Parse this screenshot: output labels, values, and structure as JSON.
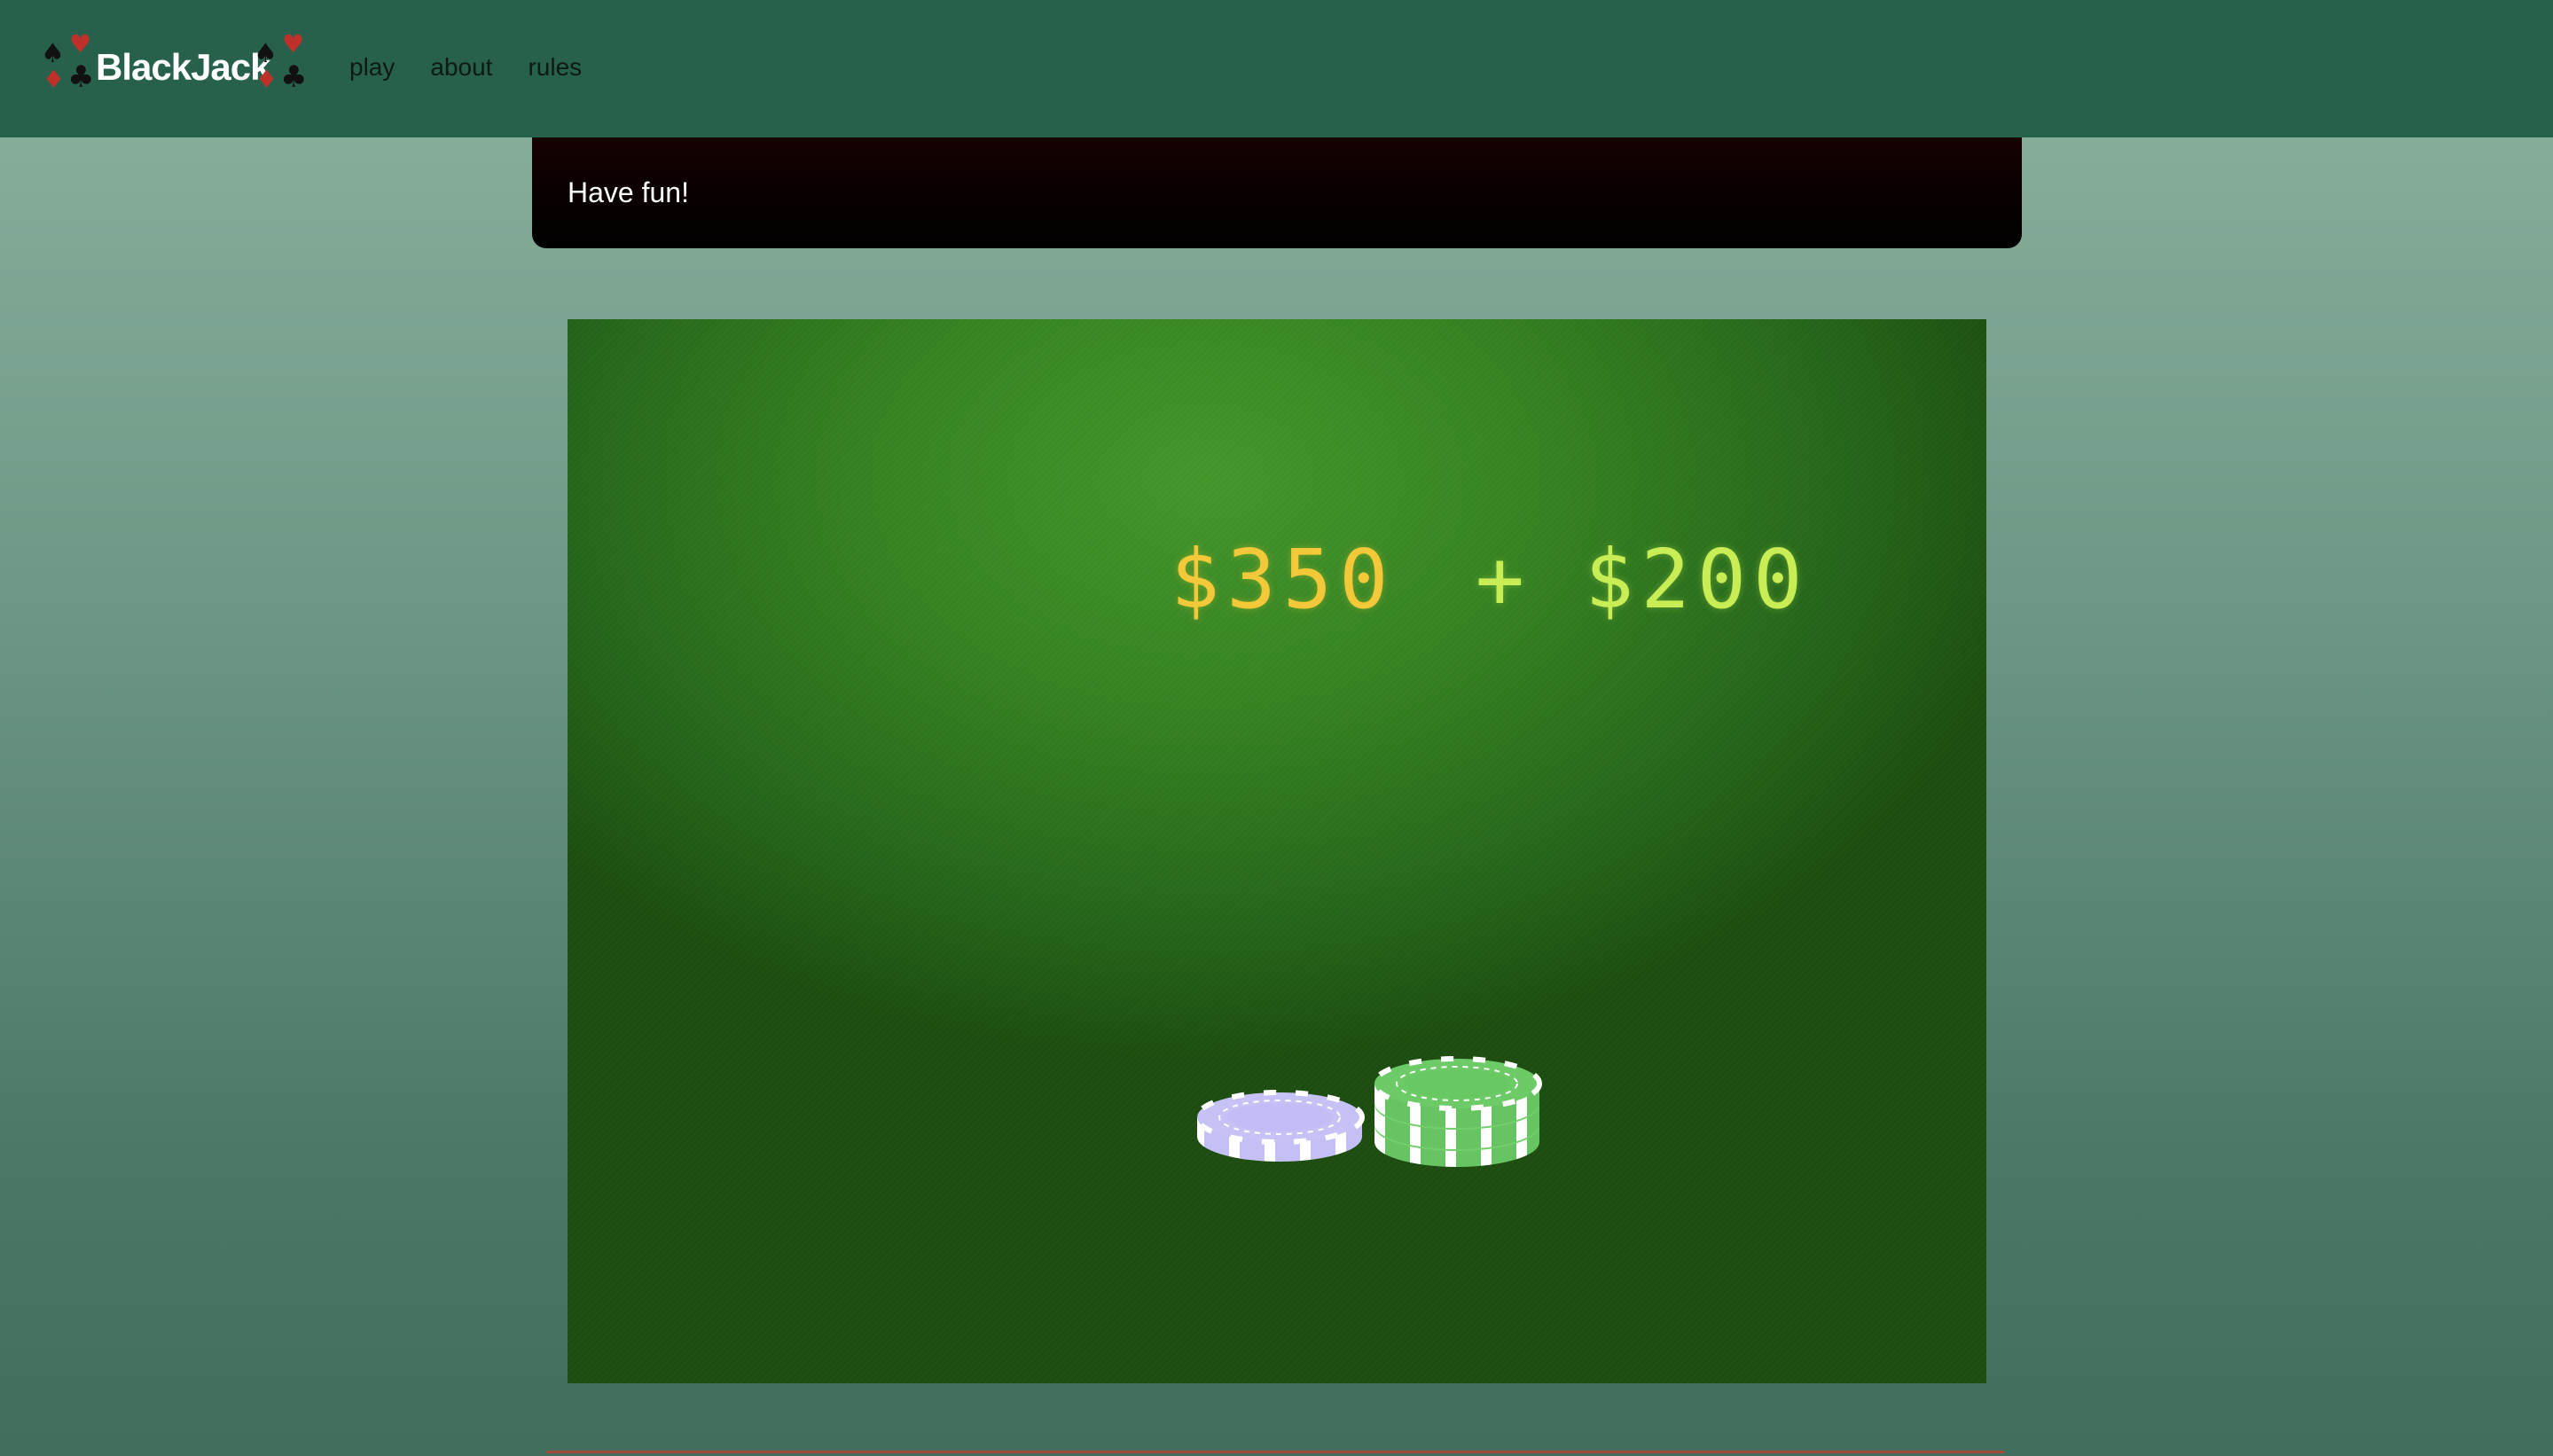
{
  "navbar": {
    "brand_text": "BlackJack",
    "links": [
      {
        "label": "play"
      },
      {
        "label": "about"
      },
      {
        "label": "rules"
      }
    ]
  },
  "message": {
    "text": "Have fun!"
  },
  "table": {
    "balance": "$350",
    "operator": "+",
    "bet": "$200",
    "chips": [
      {
        "color_name": "lavender",
        "color": "#c8c3f5",
        "count": 1
      },
      {
        "color_name": "green",
        "color": "#6cc966",
        "count": 3
      }
    ]
  },
  "colors": {
    "navbar": "#27614b",
    "felt": "#368322",
    "balance": "#f3c93a",
    "bet": "#c8ed55"
  }
}
